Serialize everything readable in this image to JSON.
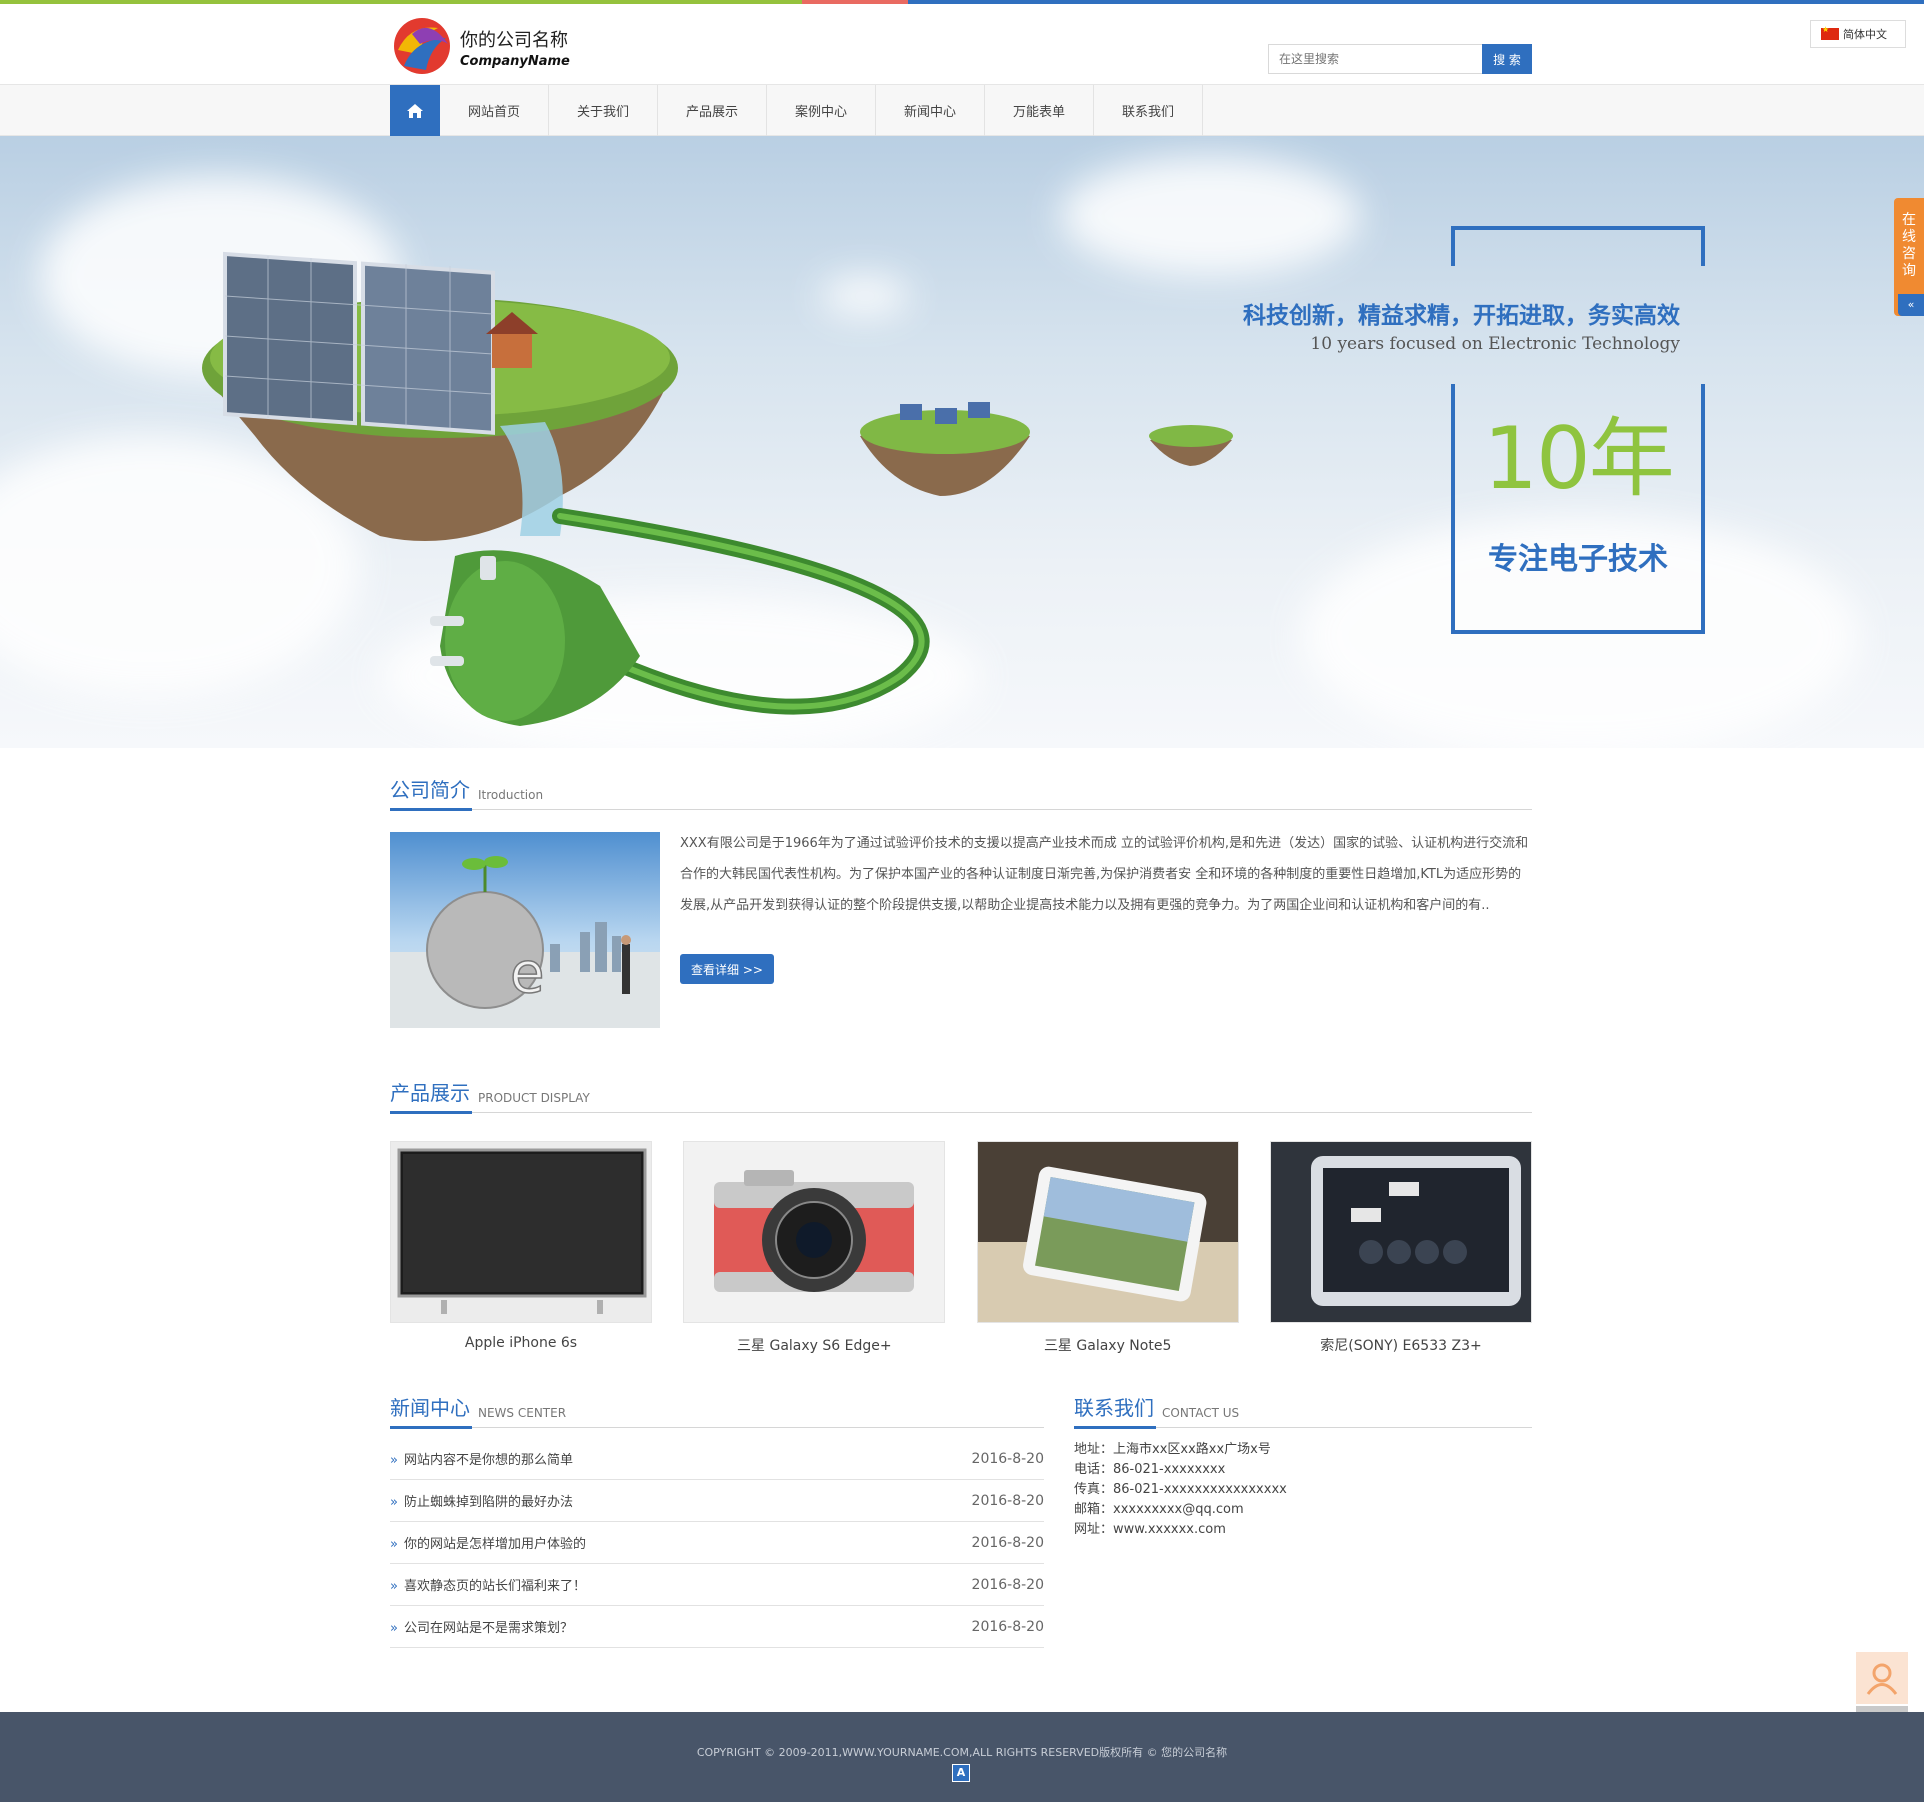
{
  "colors": {
    "accent": "#2f6fbf",
    "green": "#8fc43f",
    "orange": "#f08a31",
    "footer_bg": "#485569",
    "top_strip": [
      "#95c23d",
      "#e96a61",
      "#2f6fbf"
    ]
  },
  "header": {
    "company_name_cn": "你的公司名称",
    "company_name_en": "CompanyName",
    "search_placeholder": "在这里搜索",
    "search_button": "搜 索",
    "language": "简体中文",
    "flag_icon": "china-flag-icon"
  },
  "nav": {
    "home_icon": "home-icon",
    "items": [
      {
        "label": "网站首页"
      },
      {
        "label": "关于我们"
      },
      {
        "label": "产品展示"
      },
      {
        "label": "案例中心"
      },
      {
        "label": "新闻中心"
      },
      {
        "label": "万能表单"
      },
      {
        "label": "联系我们"
      }
    ]
  },
  "banner": {
    "slogan": "科技创新，精益求精，开拓进取，务实高效",
    "subtitle_en": "10 years focused on Electronic Technology",
    "years": "10年",
    "focus": "专注电子技术"
  },
  "side": {
    "consult": "在线咨询",
    "collapse": "«"
  },
  "intro": {
    "title": "公司简介",
    "title_en": "Itroduction",
    "text": "XXX有限公司是于1966年为了通过试验评价技术的支援以提高产业技术而成 立的试验评价机构,是和先进（发达）国家的试验、认证机构进行交流和合作的大韩民国代表性机构。为了保护本国产业的各种认证制度日渐完善,为保护消费者安 全和环境的各种制度的重要性日趋增加,KTL为适应形势的发展,从产品开发到获得认证的整个阶段提供支援,以帮助企业提高技术能力以及拥有更强的竞争力。为了两国企业间和认证机构和客户间的有..",
    "more_button": "查看详细 >>"
  },
  "products": {
    "title": "产品展示",
    "title_en": "PRODUCT DISPLAY",
    "items": [
      {
        "name": "Apple iPhone 6s",
        "image": "tv-image"
      },
      {
        "name": "三星 Galaxy S6 Edge+",
        "image": "camera-image"
      },
      {
        "name": "三星 Galaxy Note5",
        "image": "tablet-image"
      },
      {
        "name": "索尼(SONY) E6533 Z3+",
        "image": "tablet-ui-image"
      }
    ]
  },
  "news": {
    "title": "新闻中心",
    "title_en": "NEWS CENTER",
    "bullet": "»",
    "items": [
      {
        "title": "网站内容不是你想的那么简单",
        "date": "2016-8-20"
      },
      {
        "title": "防止蜘蛛掉到陷阱的最好办法",
        "date": "2016-8-20"
      },
      {
        "title": "你的网站是怎样增加用户体验的",
        "date": "2016-8-20"
      },
      {
        "title": "喜欢静态页的站长们福利来了！",
        "date": "2016-8-20"
      },
      {
        "title": "公司在网站是不是需求策划？",
        "date": "2016-8-20"
      }
    ]
  },
  "contact": {
    "title": "联系我们",
    "title_en": "CONTACT US",
    "lines": [
      "地址：上海市xx区xx路xx广场x号",
      "电话：86-021-xxxxxxxx",
      "传真：86-021-xxxxxxxxxxxxxxxx",
      "邮箱：xxxxxxxxx@qq.com",
      "网址：www.xxxxxx.com"
    ]
  },
  "footer": {
    "copyright": "COPYRIGHT © 2009-2011,WWW.YOURNAME.COM,ALL RIGHTS RESERVED版权所有 © 您的公司名称",
    "badge": "A"
  },
  "floating": {
    "user_icon": "user-icon",
    "top_icon": "back-to-top-icon"
  }
}
